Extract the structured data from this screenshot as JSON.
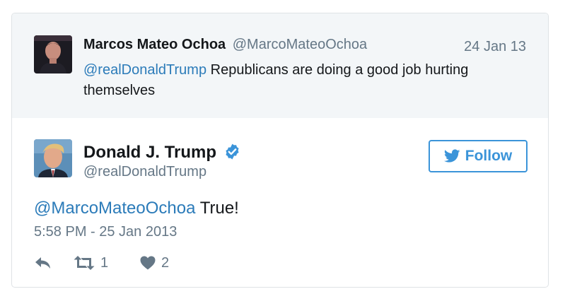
{
  "parent_tweet": {
    "name": "Marcos Mateo Ochoa",
    "handle": "@MarcoMateoOchoa",
    "date": "24 Jan 13",
    "mention": "@realDonaldTrump",
    "text": " Republicans are doing a good job hurting themselves"
  },
  "main_tweet": {
    "name": "Donald J. Trump",
    "handle": "@realDonaldTrump",
    "follow_label": "Follow",
    "mention": "@MarcoMateoOchoa",
    "text": " True!",
    "timestamp": "5:58 PM - 25 Jan 2013",
    "retweet_count": "1",
    "like_count": "2"
  },
  "icons": {
    "verified": "verified-badge-icon",
    "follow": "twitter-bird-icon",
    "reply": "reply-icon",
    "retweet": "retweet-icon",
    "like": "heart-icon"
  },
  "colors": {
    "link": "#2b7bb9",
    "follow": "#3b94d9",
    "muted": "#657786",
    "parent_bg": "#f3f6f8"
  }
}
